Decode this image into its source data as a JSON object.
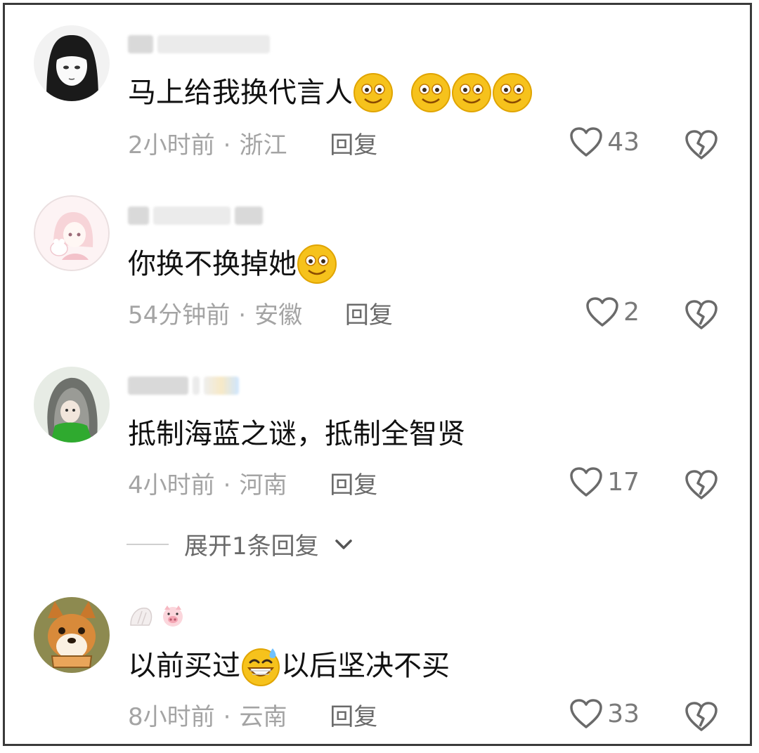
{
  "comments": [
    {
      "text": "马上给我换代言人",
      "emojis_after": 4,
      "time": "2小时前",
      "location": "浙江",
      "reply_label": "回复",
      "likes": "43"
    },
    {
      "text": "你换不换掉她",
      "emojis_after": 1,
      "time": "54分钟前",
      "location": "安徽",
      "reply_label": "回复",
      "likes": "2"
    },
    {
      "text": "抵制海蓝之谜，抵制全智贤",
      "emojis_after": 0,
      "time": "4小时前",
      "location": "河南",
      "reply_label": "回复",
      "likes": "17"
    },
    {
      "text_before": "以前买过",
      "text_after": "以后坚决不买",
      "time": "8小时前",
      "location": "云南",
      "reply_label": "回复",
      "likes": "33"
    }
  ],
  "expand_replies": "展开1条回复",
  "colors": {
    "meta": "#a4a4a4",
    "reply": "#6a6a6a",
    "emoji": "#f6c21c",
    "border": "#3a3a3a"
  },
  "icons": [
    "heart-outline-icon",
    "broken-heart-icon",
    "chevron-down-icon",
    "smile-emoji",
    "sweat-grin-emoji"
  ]
}
